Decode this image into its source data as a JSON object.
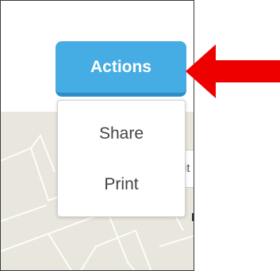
{
  "actions_button": {
    "label": "Actions",
    "color": "#45ace4"
  },
  "dropdown": {
    "items": [
      {
        "label": "Share"
      },
      {
        "label": "Print"
      }
    ]
  },
  "map": {
    "background_color": "#e8e6dd",
    "search_field_partial_text": "it"
  },
  "annotation": {
    "arrow_color": "#ee0000",
    "arrow_icon": "red-arrow-pointing-left-icon"
  }
}
